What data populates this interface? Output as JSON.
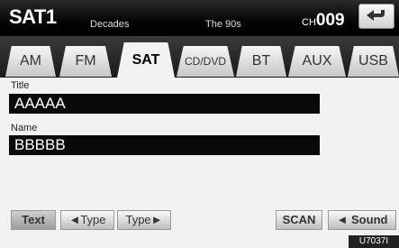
{
  "header": {
    "source": "SAT1",
    "category": "Decades",
    "song": "The 90s",
    "channel_prefix": "CH",
    "channel_number": "009",
    "back_icon": "return-arrow-icon"
  },
  "tabs": [
    {
      "label": "AM"
    },
    {
      "label": "FM"
    },
    {
      "label": "SAT"
    },
    {
      "label": "CD/DVD"
    },
    {
      "label": "BT"
    },
    {
      "label": "AUX"
    },
    {
      "label": "USB"
    }
  ],
  "active_tab": "SAT",
  "fields": {
    "title_label": "Title",
    "title_value": "AAAAA",
    "name_label": "Name",
    "name_value": "BBBBB"
  },
  "buttons": {
    "text": "Text",
    "type_prev": "◄Type",
    "type_next": "Type►",
    "scan": "SCAN",
    "sound": "◄ Sound"
  },
  "figure_code": "U7037I"
}
